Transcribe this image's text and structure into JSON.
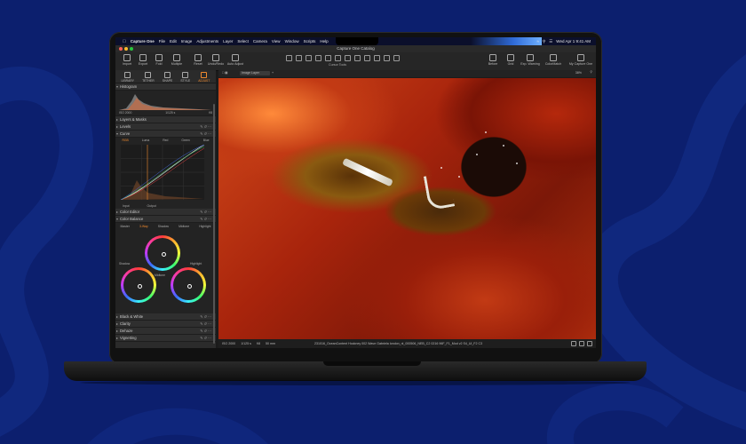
{
  "menubar": {
    "app_name": "Capture One",
    "items": [
      "File",
      "Edit",
      "Image",
      "Adjustments",
      "Layer",
      "Select",
      "Camera",
      "View",
      "Window",
      "Scripts",
      "Help"
    ],
    "clock": "Wed Apr 1  9:41 AM"
  },
  "window": {
    "title": "Capture One Catalog"
  },
  "toolbar": {
    "left_buttons": [
      "Import",
      "Export",
      "Fold",
      "Multiple",
      "Reset",
      "Undo/Redo",
      "Auto Adjust"
    ],
    "cursor_tools_label": "Cursor Tools",
    "right_buttons": [
      "Before",
      "Grid",
      "Exp. Warning",
      "ColorMatch",
      "My Capture One"
    ]
  },
  "tool_tabs": [
    {
      "label": "LIBRARY"
    },
    {
      "label": "TETHER"
    },
    {
      "label": "SHAPE"
    },
    {
      "label": "STYLE"
    },
    {
      "label": "ADJUST",
      "active": true
    }
  ],
  "histogram": {
    "title": "Histogram",
    "iso": "ISO 2000",
    "shutter": "1/125 s",
    "aperture": "f/8"
  },
  "sections": {
    "layers": "Layers & Masks",
    "levels": "Levels",
    "curve": "Curve",
    "color_editor": "Color Editor",
    "color_balance": "Color Balance",
    "bw": "Black & White",
    "clarity": "Clarity",
    "dehaze": "Dehaze",
    "vignetting": "Vignetting"
  },
  "curve": {
    "tabs": [
      "RGB",
      "Luma",
      "Red",
      "Green",
      "Blue"
    ],
    "active": "RGB",
    "input_label": "Input",
    "output_label": "Output"
  },
  "color_balance": {
    "tabs": [
      "Master",
      "3-Way",
      "Shadow",
      "Midtone",
      "Highlight"
    ],
    "active": "3-Way",
    "wheels": [
      "Shadow",
      "Midtone",
      "Highlight"
    ]
  },
  "viewer": {
    "layer": "Image Layer",
    "zoom": "38%"
  },
  "status": {
    "iso": "ISO 2000",
    "shutter": "1/125 s",
    "aperture": "f/8",
    "focal": "50 mm",
    "filename": "231016_OceanContent Hockney 002 Wave Gabriela london_nl_000506_NEB_C2 0216 96F_F1_Mod v2 S4_Ul_F2 C3"
  }
}
